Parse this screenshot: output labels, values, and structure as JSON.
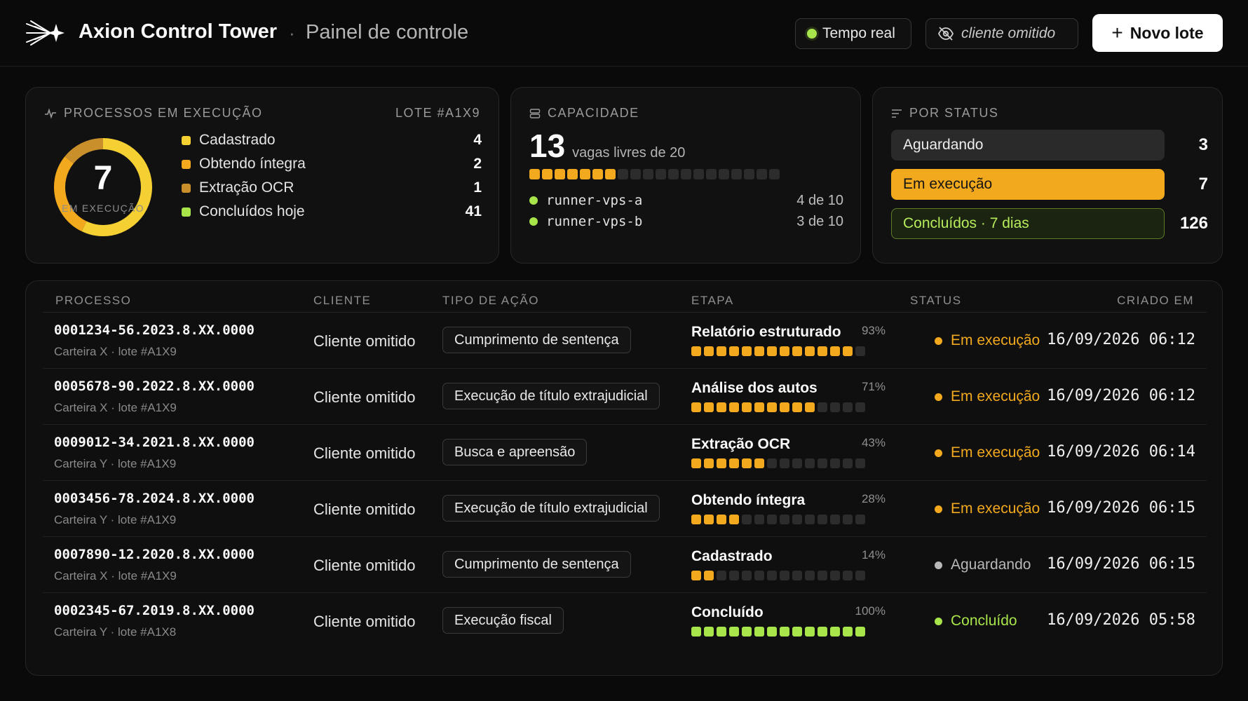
{
  "header": {
    "app_title": "Axion Control Tower",
    "separator": "·",
    "page_title": "Painel de controle",
    "realtime_label": "Tempo real",
    "client_label": "cliente omitido",
    "new_batch_label": "Novo lote",
    "new_batch_icon": "+"
  },
  "running_card": {
    "title": "PROCESSOS EM EXECUÇÃO",
    "batch": "LOTE #A1X9",
    "donut_value": "7",
    "donut_label": "EM EXECUÇÃO",
    "legend": [
      {
        "label": "Cadastrado",
        "value": "4",
        "color": "#f5d033"
      },
      {
        "label": "Obtendo íntegra",
        "value": "2",
        "color": "#f2a91e"
      },
      {
        "label": "Extração OCR",
        "value": "1",
        "color": "#c98f2a"
      },
      {
        "label": "Concluídos hoje",
        "value": "41",
        "color": "#a8e54a"
      }
    ]
  },
  "capacity_card": {
    "title": "CAPACIDADE",
    "free": "13",
    "free_text": "vagas livres de 20",
    "used_slots": 7,
    "total_slots": 20,
    "runners": [
      {
        "name": "runner-vps-a",
        "count": "4 de 10"
      },
      {
        "name": "runner-vps-b",
        "count": "3 de 10"
      }
    ]
  },
  "status_card": {
    "title": "POR STATUS",
    "rows": [
      {
        "label": "Aguardando",
        "value": "3",
        "bg": "#2a2a2a",
        "fg": "#ececec",
        "border": "#2a2a2a"
      },
      {
        "label": "Em execução",
        "value": "7",
        "bg": "#f2a91e",
        "fg": "#141414",
        "border": "#f2a91e"
      },
      {
        "label": "Concluídos · 7 dias",
        "value": "126",
        "bg": "#1b2410",
        "fg": "#b7ec5c",
        "border": "#5f7d27"
      }
    ]
  },
  "table": {
    "headers": {
      "process": "PROCESSO",
      "client": "CLIENTE",
      "action_type": "TIPO DE AÇÃO",
      "stage": "ETAPA",
      "status": "STATUS",
      "created": "CRIADO EM"
    },
    "rows": [
      {
        "process": "0001234-56.2023.8.XX.0000",
        "sub": "Carteira X · lote #A1X9",
        "client": "Cliente omitido",
        "action": "Cumprimento de sentença",
        "stage": "Relatório estruturado",
        "pct": "93%",
        "progress": 0.93,
        "status": "Em execução",
        "status_color": "#f2a91e",
        "created": "16/09/2026 06:12"
      },
      {
        "process": "0005678-90.2022.8.XX.0000",
        "sub": "Carteira X · lote #A1X9",
        "client": "Cliente omitido",
        "action": "Execução de título extrajudicial",
        "stage": "Análise dos autos",
        "pct": "71%",
        "progress": 0.71,
        "status": "Em execução",
        "status_color": "#f2a91e",
        "created": "16/09/2026 06:12"
      },
      {
        "process": "0009012-34.2021.8.XX.0000",
        "sub": "Carteira Y · lote #A1X9",
        "client": "Cliente omitido",
        "action": "Busca e apreensão",
        "stage": "Extração OCR",
        "pct": "43%",
        "progress": 0.43,
        "status": "Em execução",
        "status_color": "#f2a91e",
        "created": "16/09/2026 06:14"
      },
      {
        "process": "0003456-78.2024.8.XX.0000",
        "sub": "Carteira Y · lote #A1X9",
        "client": "Cliente omitido",
        "action": "Execução de título extrajudicial",
        "stage": "Obtendo íntegra",
        "pct": "28%",
        "progress": 0.28,
        "status": "Em execução",
        "status_color": "#f2a91e",
        "created": "16/09/2026 06:15"
      },
      {
        "process": "0007890-12.2020.8.XX.0000",
        "sub": "Carteira X · lote #A1X9",
        "client": "Cliente omitido",
        "action": "Cumprimento de sentença",
        "stage": "Cadastrado",
        "pct": "14%",
        "progress": 0.14,
        "status": "Aguardando",
        "status_color": "#b8b8b8",
        "created": "16/09/2026 06:15"
      },
      {
        "process": "0002345-67.2019.8.XX.0000",
        "sub": "Carteira Y · lote #A1X8",
        "client": "Cliente omitido",
        "action": "Execução fiscal",
        "stage": "Concluído",
        "pct": "100%",
        "progress": 1.0,
        "status": "Concluído",
        "status_color": "#a8e54a",
        "created": "16/09/2026 05:58"
      }
    ]
  }
}
